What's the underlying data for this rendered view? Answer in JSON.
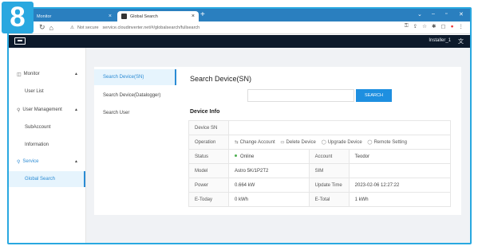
{
  "badge": "8",
  "browser": {
    "tabs": [
      {
        "label": "Monitor",
        "active": false
      },
      {
        "label": "Global Search",
        "active": true
      }
    ],
    "url_warning": "Not secure",
    "url": "service.cloudinverter.net/#/globalsearch/fullsearch"
  },
  "header": {
    "user": "Installer_1",
    "lang_icon": "translate-icon"
  },
  "sidebar": {
    "monitor": "Monitor",
    "user_list": "User List",
    "user_management": "User Management",
    "sub_account": "SubAccount",
    "information": "Information",
    "service": "Service",
    "global_search": "Global Search"
  },
  "subnav": {
    "items": [
      "Search Device(SN)",
      "Search Device(Datalogger)",
      "Search User"
    ]
  },
  "search": {
    "title": "Search Device(SN)",
    "input_value": "",
    "button": "SEARCH"
  },
  "device_info": {
    "heading": "Device Info",
    "device_sn_label": "Device SN",
    "device_sn_value": "",
    "operation_label": "Operation",
    "operations": [
      "Change Account",
      "Delete Device",
      "Upgrade Device",
      "Remote Setting"
    ],
    "status_label": "Status",
    "status_value": "Online",
    "account_label": "Account",
    "account_value": "Teodor",
    "model_label": "Model",
    "model_value": "Astro 5K/1P2T2",
    "sim_label": "SIM",
    "sim_value": "",
    "power_label": "Power",
    "power_value": "0.664 kW",
    "update_label": "Update Time",
    "update_value": "2023-02-06 12:27:22",
    "etoday_label": "E-Today",
    "etoday_value": "0 kWh",
    "etotal_label": "E-Total",
    "etotal_value": "1 kWh"
  }
}
